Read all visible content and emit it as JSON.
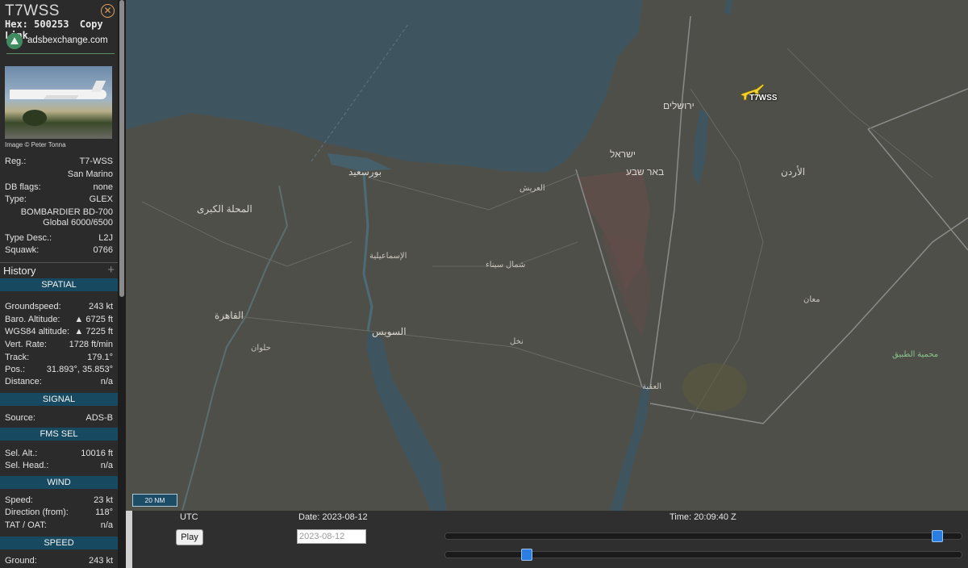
{
  "aircraft": {
    "callsign": "T7WSS",
    "hex_label": "Hex:",
    "hex": "500253",
    "copy_link": "Copy Link",
    "source_site": "adsbexchange.com",
    "photo_credit": "Image © Peter Tonna"
  },
  "details": [
    {
      "key": "Reg.:",
      "value": "T7-WSS"
    },
    {
      "key": "",
      "value": "San Marino"
    },
    {
      "key": "DB flags:",
      "value": "none"
    },
    {
      "key": "Type:",
      "value": "GLEX"
    },
    {
      "key": "",
      "value": "BOMBARDIER BD-700"
    },
    {
      "key": "",
      "value": "Global 6000/6500"
    },
    {
      "key": "Type Desc.:",
      "value": "L2J"
    },
    {
      "key": "Squawk:",
      "value": "0766"
    }
  ],
  "history_label": "History",
  "history_plus": "+",
  "sections": {
    "spatial": {
      "title": "SPATIAL",
      "rows": [
        {
          "key": "Groundspeed:",
          "value": "243 kt"
        },
        {
          "key": "Baro. Altitude:",
          "value": "▲ 6725 ft"
        },
        {
          "key": "WGS84 altitude:",
          "value": "▲ 7225 ft"
        },
        {
          "key": "Vert. Rate:",
          "value": "1728 ft/min"
        },
        {
          "key": "Track:",
          "value": "179.1°"
        },
        {
          "key": "Pos.:",
          "value": "31.893°, 35.853°"
        },
        {
          "key": "Distance:",
          "value": "n/a"
        }
      ]
    },
    "signal": {
      "title": "SIGNAL",
      "rows": [
        {
          "key": "Source:",
          "value": "ADS-B"
        }
      ]
    },
    "fms": {
      "title": "FMS SEL",
      "rows": [
        {
          "key": "Sel. Alt.:",
          "value": "10016 ft"
        },
        {
          "key": "Sel. Head.:",
          "value": "n/a"
        }
      ]
    },
    "wind": {
      "title": "WIND",
      "rows": [
        {
          "key": "Speed:",
          "value": "23 kt"
        },
        {
          "key": "Direction (from):",
          "value": "118°"
        },
        {
          "key": "TAT / OAT:",
          "value": "n/a"
        }
      ]
    },
    "speed": {
      "title": "SPEED",
      "rows": [
        {
          "key": "Ground:",
          "value": "243 kt"
        }
      ]
    }
  },
  "map": {
    "plane_label": "T7WSS",
    "scale": "20 NM",
    "labels": {
      "cairo": "القاهرة",
      "helwan": "حلوان",
      "suez": "السويس",
      "port_said": "بورسعيد",
      "mahalla": "المحلة الكبرى",
      "north_sinai": "شمال سيناء",
      "beersheba": "באר שבע",
      "israel": "ישראל",
      "jerusalem": "ירושלים",
      "jordan": "الأردن",
      "maan": "معان",
      "aqaba": "العقبة",
      "nakhl": "نخل",
      "tabuk_reserve": "محمية الطبيق",
      "ismailia": "الإسماعيلية",
      "arish": "العريش"
    }
  },
  "playback": {
    "utc": "UTC",
    "play": "Play",
    "date_label": "Date: 2023-08-12",
    "date_value": "2023-08-12",
    "time_label": "Time: 20:09:40 Z",
    "time_slider_fraction": 0.96,
    "speed_slider_fraction": 0.15
  },
  "colors": {
    "section_header": "#174a60",
    "sea": "#3e5560",
    "land": "#4f4f4a",
    "plane": "#f2d22e",
    "slider_thumb": "#2a7de1"
  }
}
